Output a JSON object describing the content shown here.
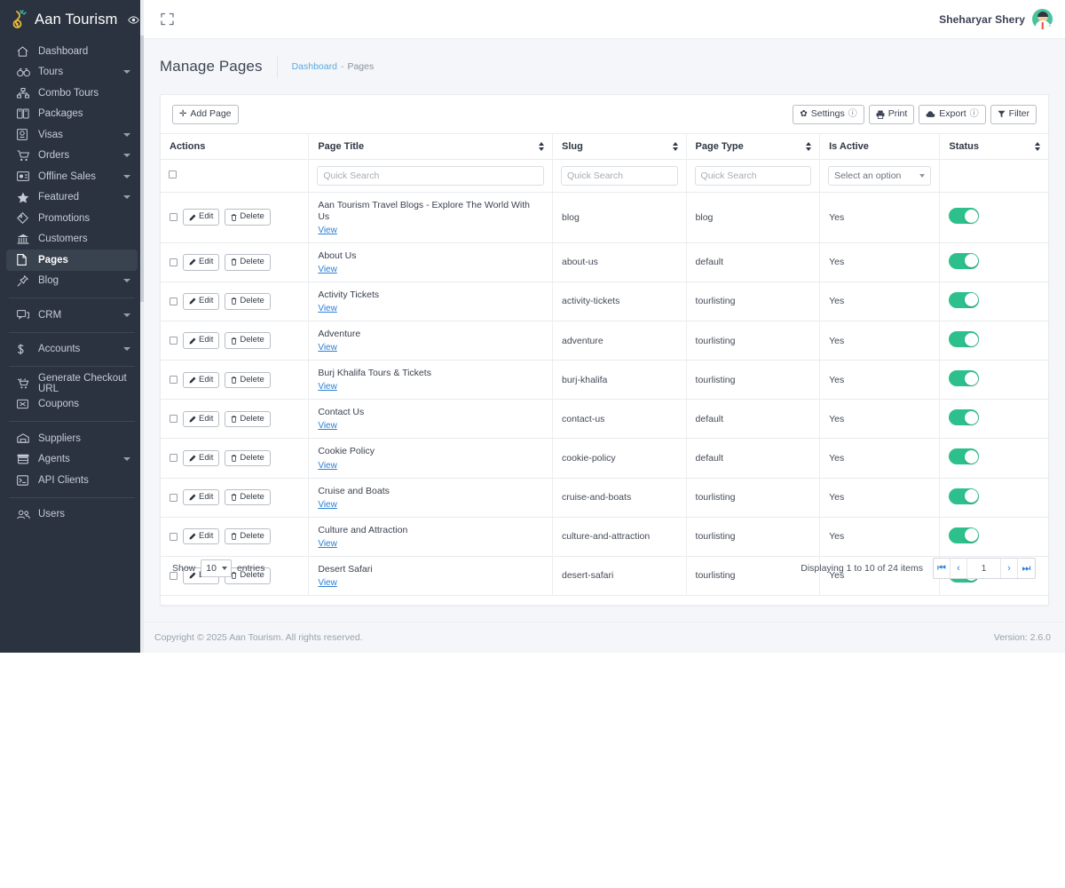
{
  "brand": {
    "title": "Aan Tourism",
    "logo_icon": "aan-logo-icon",
    "eye_icon": "eye-icon"
  },
  "sidebar": {
    "items": [
      {
        "label": "Dashboard",
        "icon": "home-icon",
        "caret": false,
        "active": false
      },
      {
        "label": "Tours",
        "icon": "binoculars-icon",
        "caret": true,
        "active": false
      },
      {
        "label": "Combo Tours",
        "icon": "sitemap-icon",
        "caret": false,
        "active": false
      },
      {
        "label": "Packages",
        "icon": "packages-icon",
        "caret": false,
        "active": false
      },
      {
        "label": "Visas",
        "icon": "passport-icon",
        "caret": true,
        "active": false
      },
      {
        "label": "Orders",
        "icon": "cart-icon",
        "caret": true,
        "active": false
      },
      {
        "label": "Offline Sales",
        "icon": "offline-sales-icon",
        "caret": true,
        "active": false
      },
      {
        "label": "Featured",
        "icon": "star-icon",
        "caret": true,
        "active": false
      },
      {
        "label": "Promotions",
        "icon": "tag-icon",
        "caret": false,
        "active": false
      },
      {
        "label": "Customers",
        "icon": "bank-icon",
        "caret": false,
        "active": false
      },
      {
        "label": "Pages",
        "icon": "file-icon",
        "caret": false,
        "active": true
      },
      {
        "label": "Blog",
        "icon": "pin-icon",
        "caret": true,
        "active": false
      },
      {
        "label": "CRM",
        "icon": "chat-icon",
        "caret": true,
        "active": false
      },
      {
        "label": "Accounts",
        "icon": "dollar-icon",
        "caret": true,
        "active": false
      },
      {
        "label": "Generate Checkout URL",
        "icon": "checkout-cart-icon",
        "caret": false,
        "active": false
      },
      {
        "label": "Coupons",
        "icon": "coupon-icon",
        "caret": false,
        "active": false
      },
      {
        "label": "Suppliers",
        "icon": "warehouse-icon",
        "caret": false,
        "active": false
      },
      {
        "label": "Agents",
        "icon": "agents-icon",
        "caret": true,
        "active": false
      },
      {
        "label": "API Clients",
        "icon": "terminal-icon",
        "caret": false,
        "active": false
      },
      {
        "label": "Users",
        "icon": "users-icon",
        "caret": false,
        "active": false
      }
    ]
  },
  "topbar": {
    "expand_icon": "expand-icon",
    "user_name": "Sheharyar Shery",
    "avatar_icon": "avatar"
  },
  "page": {
    "title": "Manage Pages",
    "breadcrumb_root": "Dashboard",
    "breadcrumb_sep": "-",
    "breadcrumb_current": "Pages"
  },
  "toolbar": {
    "add_label": "Add Page",
    "add_icon": "plus-icon",
    "settings_label": "Settings",
    "settings_icon": "gear-icon",
    "settings_info_icon": "info-circle-icon",
    "print_label": "Print",
    "print_icon": "printer-icon",
    "export_label": "Export",
    "export_icon": "cloud-upload-icon",
    "export_info_icon": "info-circle-icon",
    "filter_label": "Filter",
    "filter_icon": "funnel-icon"
  },
  "table": {
    "columns": [
      {
        "label": "Actions",
        "sortable": false
      },
      {
        "label": "Page Title",
        "sortable": true
      },
      {
        "label": "Slug",
        "sortable": true
      },
      {
        "label": "Page Type",
        "sortable": true
      },
      {
        "label": "Is Active",
        "sortable": false
      },
      {
        "label": "Status",
        "sortable": true
      }
    ],
    "filters": {
      "quick_search_placeholder": "Quick Search",
      "title_value": "",
      "slug_value": "",
      "page_type_value": "",
      "is_active_select": "Select an option"
    },
    "row_actions": {
      "edit_label": "Edit",
      "edit_icon": "pencil-icon",
      "delete_label": "Delete",
      "delete_icon": "trash-icon",
      "view_label": "View"
    },
    "rows": [
      {
        "title": "Aan Tourism Travel Blogs - Explore The World With Us",
        "slug": "blog",
        "page_type": "blog",
        "is_active": "Yes",
        "status_on": true
      },
      {
        "title": "About Us",
        "slug": "about-us",
        "page_type": "default",
        "is_active": "Yes",
        "status_on": true
      },
      {
        "title": "Activity Tickets",
        "slug": "activity-tickets",
        "page_type": "tourlisting",
        "is_active": "Yes",
        "status_on": true
      },
      {
        "title": "Adventure",
        "slug": "adventure",
        "page_type": "tourlisting",
        "is_active": "Yes",
        "status_on": true
      },
      {
        "title": "Burj Khalifa Tours & Tickets",
        "slug": "burj-khalifa",
        "page_type": "tourlisting",
        "is_active": "Yes",
        "status_on": true
      },
      {
        "title": "Contact Us",
        "slug": "contact-us",
        "page_type": "default",
        "is_active": "Yes",
        "status_on": true
      },
      {
        "title": "Cookie Policy",
        "slug": "cookie-policy",
        "page_type": "default",
        "is_active": "Yes",
        "status_on": true
      },
      {
        "title": "Cruise and Boats",
        "slug": "cruise-and-boats",
        "page_type": "tourlisting",
        "is_active": "Yes",
        "status_on": true
      },
      {
        "title": "Culture and Attraction",
        "slug": "culture-and-attraction",
        "page_type": "tourlisting",
        "is_active": "Yes",
        "status_on": true
      },
      {
        "title": "Desert Safari",
        "slug": "desert-safari",
        "page_type": "tourlisting",
        "is_active": "Yes",
        "status_on": true
      }
    ]
  },
  "pagination": {
    "show_label": "Show",
    "entries_label": "entries",
    "page_size": "10",
    "info": "Displaying 1 to 10 of 24 items",
    "first_icon": "first-page-icon",
    "prev_icon": "prev-page-icon",
    "current_page": "1",
    "next_icon": "next-page-icon",
    "last_icon": "last-page-icon"
  },
  "footer": {
    "copyright": "Copyright © 2025 Aan Tourism. All rights reserved.",
    "version": "Version: 2.6.0"
  },
  "colors": {
    "sidebar_bg": "#2b3340",
    "accent_green": "#2dc08d",
    "link_blue": "#2b7fd4",
    "page_bg": "#f4f6f9"
  }
}
